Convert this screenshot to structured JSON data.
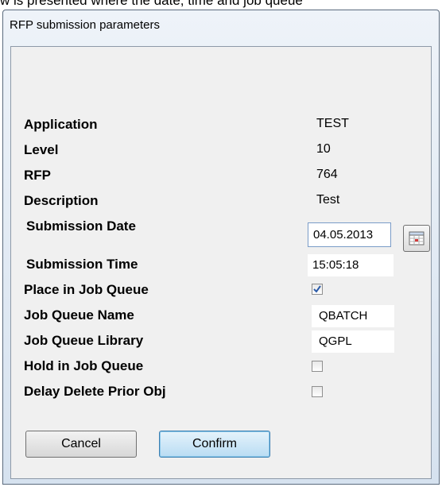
{
  "caption": "w is presented where the date, time and job queue",
  "dialog": {
    "title": "RFP submission parameters"
  },
  "fields": {
    "application": {
      "label": "Application",
      "value": "TEST"
    },
    "level": {
      "label": "Level",
      "value": "10"
    },
    "rfp": {
      "label": "RFP",
      "value": "764"
    },
    "description": {
      "label": "Description",
      "value": "Test"
    },
    "submission_date": {
      "label": "Submission Date",
      "value": "04.05.2013"
    },
    "submission_time": {
      "label": "Submission Time",
      "value": "15:05:18"
    },
    "place_in_job_queue": {
      "label": "Place in Job Queue",
      "checked": true
    },
    "job_queue_name": {
      "label": "Job Queue Name",
      "value": "QBATCH"
    },
    "job_queue_library": {
      "label": "Job Queue Library",
      "value": "QGPL"
    },
    "hold_in_job_queue": {
      "label": "Hold in Job Queue",
      "checked": false
    },
    "delay_delete_prior_obj": {
      "label": "Delay Delete Prior Obj",
      "checked": false
    }
  },
  "buttons": {
    "cancel": "Cancel",
    "confirm": "Confirm"
  },
  "icons": {
    "calendar": "calendar-icon",
    "check": "checkmark-icon"
  },
  "colors": {
    "confirm_border": "#3c7fb1",
    "check_mark": "#2a5aa8"
  }
}
